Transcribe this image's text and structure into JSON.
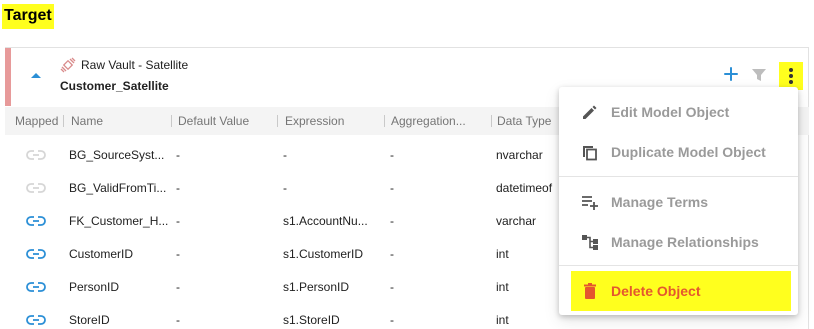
{
  "target_label": "Target",
  "entity": {
    "type_label": "Raw Vault - Satellite",
    "name": "Customer_Satellite"
  },
  "columns": [
    "Mapped",
    "Name",
    "Default Value",
    "Expression",
    "Aggregation...",
    "Data Type"
  ],
  "rows": [
    {
      "mapped": "unlinked",
      "name": "BG_SourceSyst...",
      "default": "-",
      "expression": "-",
      "aggregation": "-",
      "datatype": "nvarchar"
    },
    {
      "mapped": "unlinked",
      "name": "BG_ValidFromTi...",
      "default": "-",
      "expression": "-",
      "aggregation": "-",
      "datatype": "datetimeof"
    },
    {
      "mapped": "linked",
      "name": "FK_Customer_H...",
      "default": "-",
      "expression": "s1.AccountNu...",
      "aggregation": "-",
      "datatype": "varchar"
    },
    {
      "mapped": "linked",
      "name": "CustomerID",
      "default": "-",
      "expression": "s1.CustomerID",
      "aggregation": "-",
      "datatype": "int"
    },
    {
      "mapped": "linked",
      "name": "PersonID",
      "default": "-",
      "expression": "s1.PersonID",
      "aggregation": "-",
      "datatype": "int"
    },
    {
      "mapped": "linked",
      "name": "StoreID",
      "default": "-",
      "expression": "s1.StoreID",
      "aggregation": "-",
      "datatype": "int"
    }
  ],
  "menu": {
    "items": [
      {
        "icon": "pencil-icon",
        "label": "Edit Model Object"
      },
      {
        "icon": "duplicate-icon",
        "label": "Duplicate Model Object"
      },
      {
        "icon": "manage-terms-icon",
        "label": "Manage Terms"
      },
      {
        "icon": "relationships-icon",
        "label": "Manage Relationships"
      },
      {
        "icon": "trash-icon",
        "label": "Delete Object"
      }
    ]
  },
  "colors": {
    "accent_blue": "#2b8fd6",
    "highlight": "#ffff1e",
    "danger": "#e4572e",
    "satellite_stripe": "#e79a9a"
  }
}
